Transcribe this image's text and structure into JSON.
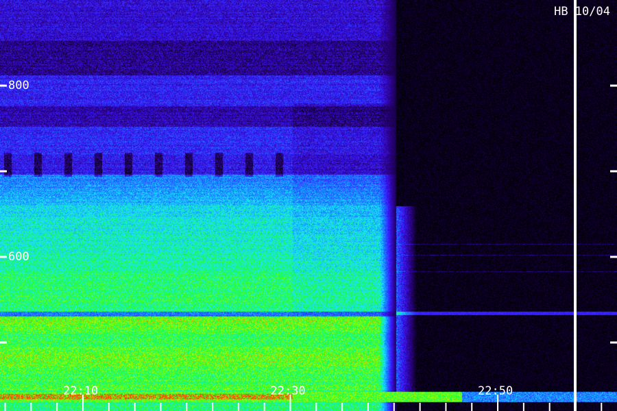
{
  "chart_data": {
    "type": "heatmap",
    "title": "",
    "xlabel": "",
    "ylabel": "",
    "station_label": "HB 10/04",
    "x_ticks": [
      {
        "time": "22:10",
        "minute": 10
      },
      {
        "time": "22:30",
        "minute": 30
      },
      {
        "time": "22:50",
        "minute": 50
      }
    ],
    "x_range_minutes": [
      2,
      61.5
    ],
    "minor_tick_step_minutes": 2.5,
    "y_ticks": [
      {
        "label": "800",
        "value": 800
      },
      {
        "label": "",
        "value": 700
      },
      {
        "label": "600",
        "value": 600
      },
      {
        "label": "",
        "value": 500
      }
    ],
    "y_range": [
      420,
      900
    ],
    "cursor_minute": 57.5,
    "activity_end_minute": 40.2,
    "bright_band_end_minute": 46.5,
    "colormap": [
      "#000000",
      "#2a0080",
      "#3a18ff",
      "#1a7bff",
      "#19e6ff",
      "#1cff30",
      "#b0ff00",
      "#ff2a00"
    ],
    "colors": {
      "text": "#ffffff",
      "cursor": "#ffffff",
      "background": "#000000"
    }
  }
}
